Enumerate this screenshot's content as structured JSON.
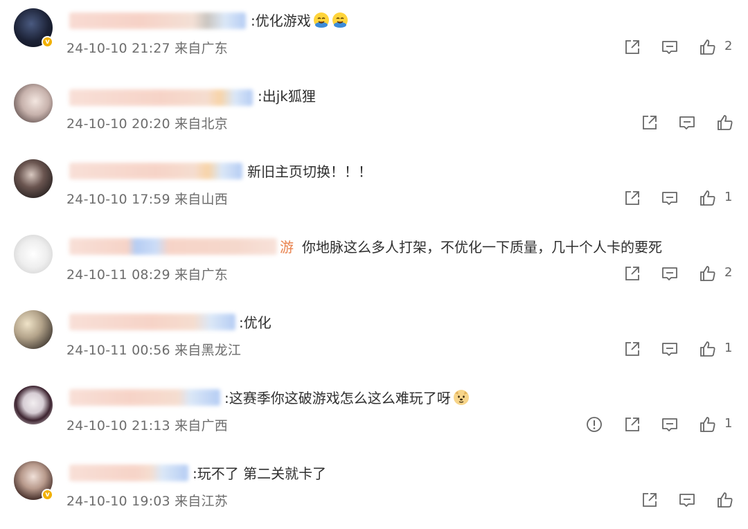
{
  "comments": [
    {
      "text": ":优化游戏",
      "time": "24-10-10 21:27",
      "location": "来自广东",
      "likes": "2",
      "verified": true,
      "emojis": [
        "laugh-cry-emoji",
        "laugh-cry-emoji"
      ]
    },
    {
      "text": ":出jk狐狸",
      "time": "24-10-10 20:20",
      "location": "来自北京",
      "likes": "",
      "verified": false,
      "emojis": []
    },
    {
      "text": "新旧主页切换！！！",
      "time": "24-10-10 17:59",
      "location": "来自山西",
      "likes": "1",
      "verified": false,
      "emojis": []
    },
    {
      "prefix": "游",
      "text": "你地脉这么多人打架，不优化一下质量，几十个人卡的要死",
      "time": "24-10-11 08:29",
      "location": "来自广东",
      "likes": "2",
      "verified": false,
      "emojis": []
    },
    {
      "text": ":优化",
      "time": "24-10-11 00:56",
      "location": "来自黑龙江",
      "likes": "1",
      "verified": false,
      "emojis": []
    },
    {
      "text": ":这赛季你这破游戏怎么这么难玩了呀",
      "time": "24-10-10 21:13",
      "location": "来自广西",
      "likes": "1",
      "verified": false,
      "emojis": [
        "doge-emoji"
      ],
      "has_report": true
    },
    {
      "text": ":玩不了 第二关就卡了",
      "time": "24-10-10 19:03",
      "location": "来自江苏",
      "likes": "",
      "verified": true,
      "emojis": []
    }
  ],
  "icons": {
    "share": "share-icon",
    "comment": "comment-icon",
    "like": "like-icon",
    "report": "report-icon"
  },
  "colors": {
    "text": "#2f2f2f",
    "meta": "#6d6d6d",
    "icon": "#666666",
    "verified": "#f1b000"
  }
}
